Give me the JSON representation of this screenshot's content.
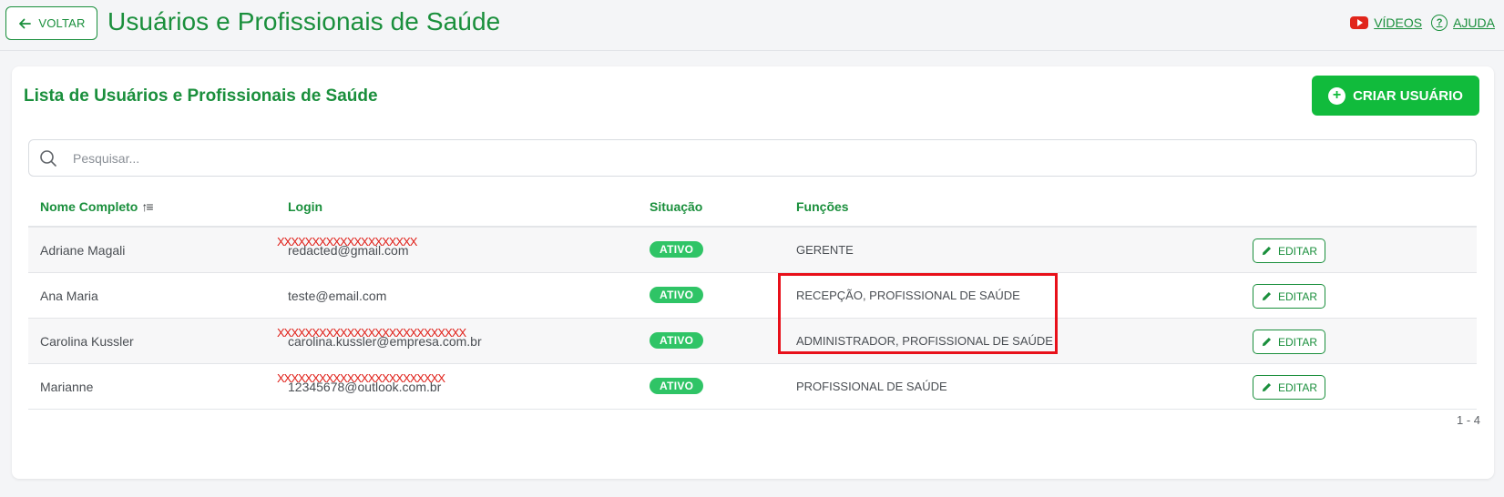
{
  "header": {
    "back_label": "VOLTAR",
    "title": "Usuários e Profissionais de Saúde",
    "videos_label": "VÍDEOS",
    "help_label": "AJUDA"
  },
  "card": {
    "title": "Lista de Usuários e Profissionais de Saúde",
    "create_label": "CRIAR USUÁRIO",
    "search_placeholder": "Pesquisar..."
  },
  "table": {
    "columns": {
      "name": "Nome Completo",
      "login": "Login",
      "status": "Situação",
      "roles": "Funções"
    },
    "rows": [
      {
        "name": "Adriane Magali",
        "login": "redacted@gmail.com",
        "redaction": "XXXXXXXXXXXXXXXXXXXX",
        "status": "ATIVO",
        "roles": "GERENTE",
        "action": "EDITAR"
      },
      {
        "name": "Ana Maria",
        "login": "teste@email.com",
        "redaction": "",
        "status": "ATIVO",
        "roles": "RECEPÇÃO, PROFISSIONAL DE SAÚDE",
        "action": "EDITAR"
      },
      {
        "name": "Carolina Kussler",
        "login": "carolina.kussler@empresa.com.br",
        "redaction": "XXXXXXXXXXXXXXXXXXXXXXXXXXX",
        "status": "ATIVO",
        "roles": "ADMINISTRADOR, PROFISSIONAL DE SAÚDE",
        "action": "EDITAR"
      },
      {
        "name": "Marianne",
        "login": "12345678@outlook.com.br",
        "redaction": "XXXXXXXXXXXXXXXXXXXXXXXX",
        "status": "ATIVO",
        "roles": "PROFISSIONAL DE SAÚDE",
        "action": "EDITAR"
      }
    ],
    "pagination": "1 - 4"
  },
  "colors": {
    "brand_green": "#1a8f3c",
    "button_green": "#11bb3c",
    "badge_green": "#2fc466",
    "highlight_red": "#e8101a"
  }
}
